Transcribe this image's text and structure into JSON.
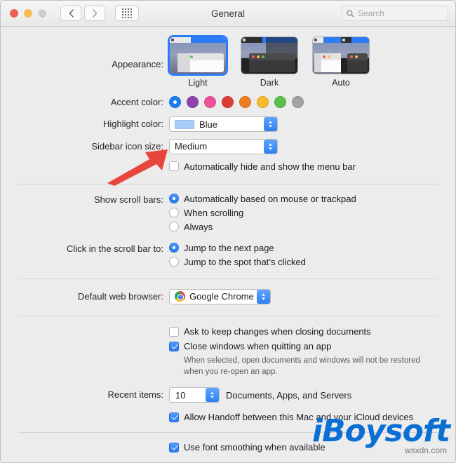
{
  "window": {
    "title": "General",
    "traffic": {
      "close": "close-button",
      "minimize": "minimize-button",
      "zoom": "zoom-button"
    },
    "nav": {
      "back": "‹",
      "forward": "›",
      "grid": "show-all-button"
    },
    "search": {
      "placeholder": "Search",
      "icon": "search-icon",
      "value": ""
    }
  },
  "appearance": {
    "label": "Appearance:",
    "options": [
      {
        "name": "Light",
        "selected": true
      },
      {
        "name": "Dark",
        "selected": false
      },
      {
        "name": "Auto",
        "selected": false
      }
    ]
  },
  "accent": {
    "label": "Accent color:",
    "colors": [
      {
        "name": "blue",
        "hex": "#1a7df5",
        "selected": true
      },
      {
        "name": "purple",
        "hex": "#8d44ad",
        "selected": false
      },
      {
        "name": "pink",
        "hex": "#f0519a",
        "selected": false
      },
      {
        "name": "red",
        "hex": "#dc3c37",
        "selected": false
      },
      {
        "name": "orange",
        "hex": "#f07e21",
        "selected": false
      },
      {
        "name": "yellow",
        "hex": "#f5bb2b",
        "selected": false
      },
      {
        "name": "green",
        "hex": "#5bbf47",
        "selected": false
      },
      {
        "name": "graphite",
        "hex": "#a3a3a3",
        "selected": false
      }
    ]
  },
  "highlight": {
    "label": "Highlight color:",
    "value": "Blue",
    "swatch_hex": "#a6cdf5"
  },
  "sidebar_icon_size": {
    "label": "Sidebar icon size:",
    "value": "Medium"
  },
  "menu_bar": {
    "autohide_label": "Automatically hide and show the menu bar",
    "autohide_checked": false
  },
  "scroll_bars": {
    "label": "Show scroll bars:",
    "options": [
      {
        "label": "Automatically based on mouse or trackpad",
        "selected": true
      },
      {
        "label": "When scrolling",
        "selected": false
      },
      {
        "label": "Always",
        "selected": false
      }
    ]
  },
  "scroll_click": {
    "label": "Click in the scroll bar to:",
    "options": [
      {
        "label": "Jump to the next page",
        "selected": true
      },
      {
        "label": "Jump to the spot that’s clicked",
        "selected": false
      }
    ]
  },
  "browser": {
    "label": "Default web browser:",
    "value": "Google Chrome",
    "icon": "chrome-icon"
  },
  "documents": {
    "ask_keep_changes": {
      "label": "Ask to keep changes when closing documents",
      "checked": false
    },
    "close_windows": {
      "label": "Close windows when quitting an app",
      "checked": true
    },
    "help_line1": "When selected, open documents and windows will not be restored",
    "help_line2": "when you re-open an app."
  },
  "recent_items": {
    "label": "Recent items:",
    "value": "10",
    "suffix": "Documents, Apps, and Servers"
  },
  "handoff": {
    "label": "Allow Handoff between this Mac and your iCloud devices",
    "checked": true
  },
  "font_smoothing": {
    "label": "Use font smoothing when available",
    "checked": true
  },
  "annotation": {
    "arrow": "red-arrow-pointer",
    "color": "#e8453c"
  },
  "watermark": {
    "brand": "iBoysoft",
    "site": "wsxdn.com"
  }
}
